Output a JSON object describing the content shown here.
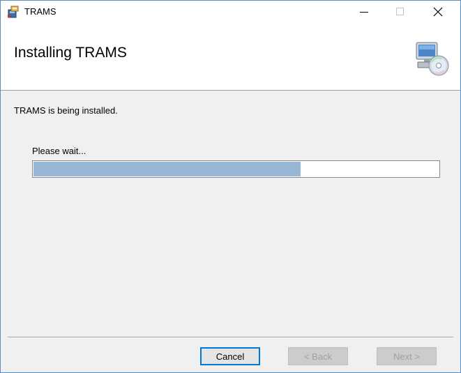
{
  "window": {
    "title": "TRAMS",
    "icons": {
      "app": "installer-box-icon",
      "banner": "computer-cd-icon"
    }
  },
  "header": {
    "title": "Installing TRAMS"
  },
  "body": {
    "status": "TRAMS is being installed.",
    "wait_label": "Please wait...",
    "progress_fraction": 0.66
  },
  "footer": {
    "cancel_label": "Cancel",
    "back_label": "< Back",
    "next_label": "Next >"
  },
  "colors": {
    "progress_fill": "#98b6d6",
    "window_border": "#5b8cc4",
    "focus_border": "#0078d7"
  }
}
